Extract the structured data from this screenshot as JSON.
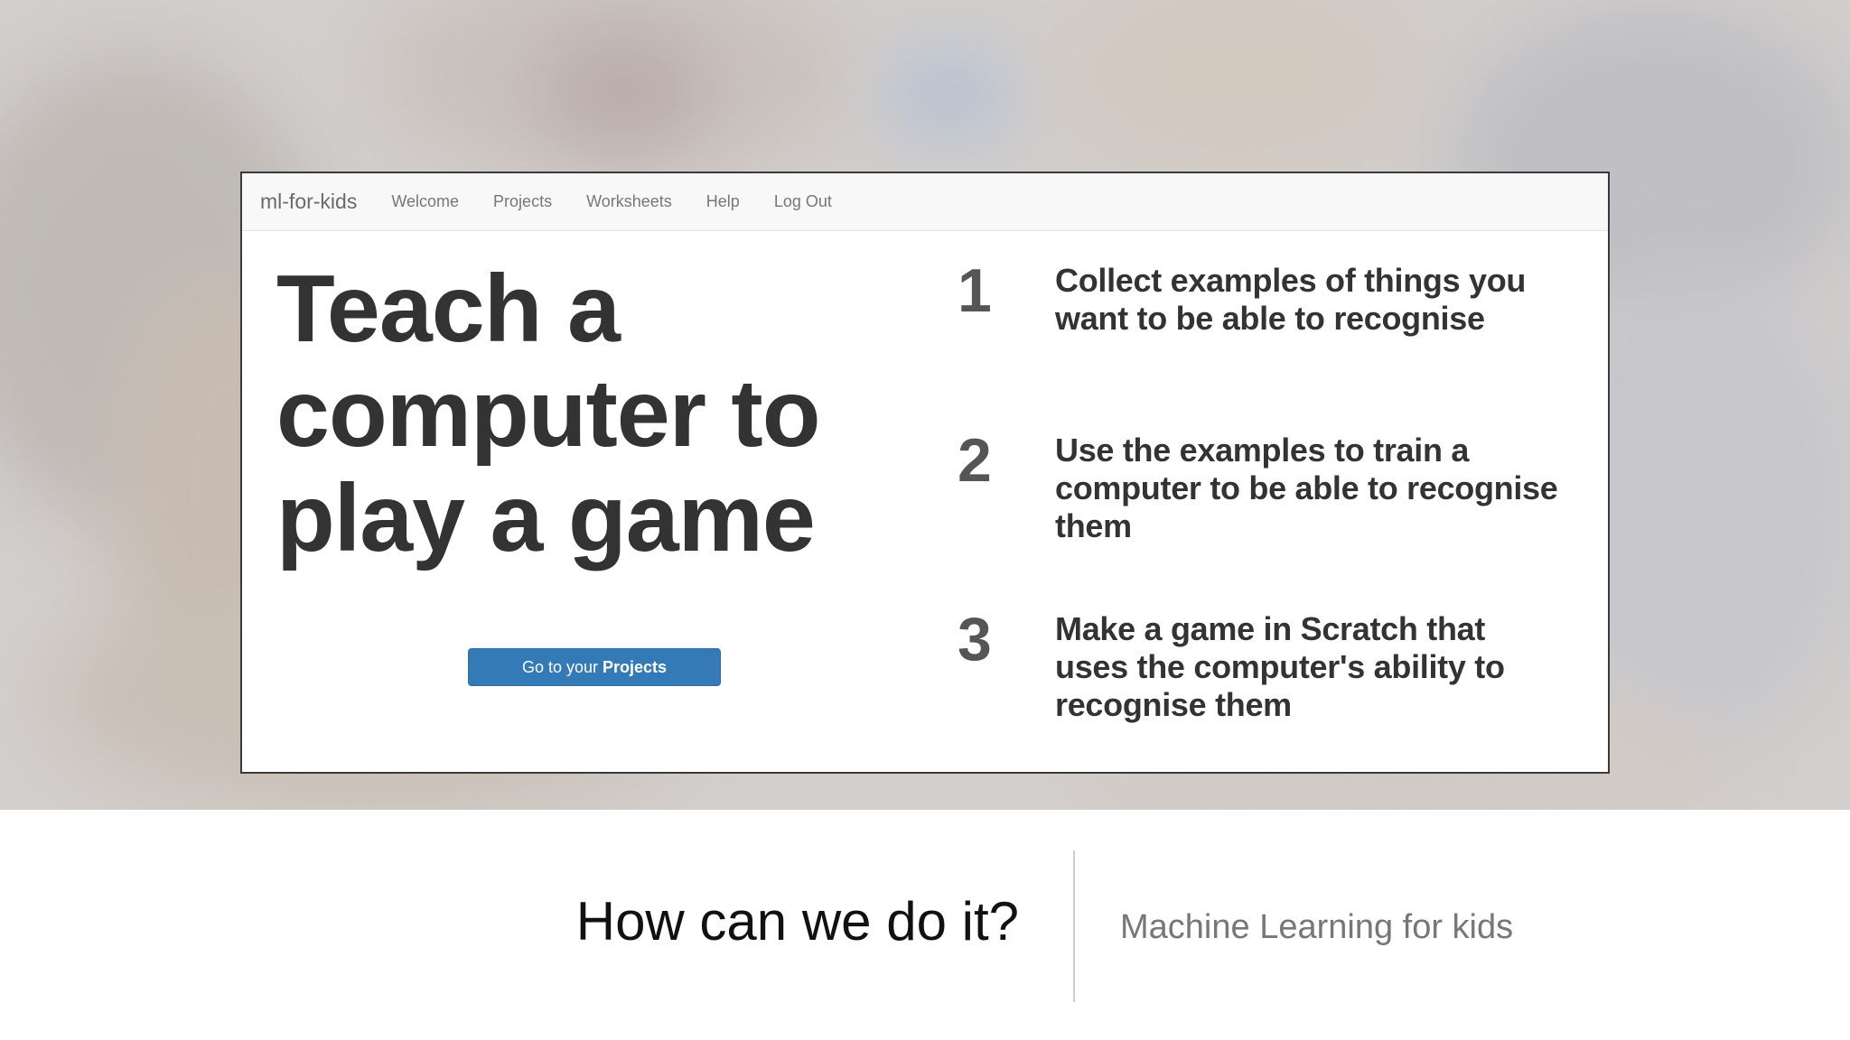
{
  "navbar": {
    "brand": "ml-for-kids",
    "items": [
      "Welcome",
      "Projects",
      "Worksheets",
      "Help",
      "Log Out"
    ]
  },
  "hero": {
    "heading": "Teach a computer to play a game",
    "button_prefix": "Go to your",
    "button_bold": "Projects",
    "button_color": "#337ab7"
  },
  "steps": [
    {
      "number": "1",
      "text": "Collect examples of things you want to be able to recognise"
    },
    {
      "number": "2",
      "text": "Use the examples to train a computer to be able to recognise them"
    },
    {
      "number": "3",
      "text": "Make a game in Scratch that uses the computer's ability to recognise them"
    }
  ],
  "footer": {
    "title": "How can we do it?",
    "subtitle": "Machine Learning for kids"
  }
}
